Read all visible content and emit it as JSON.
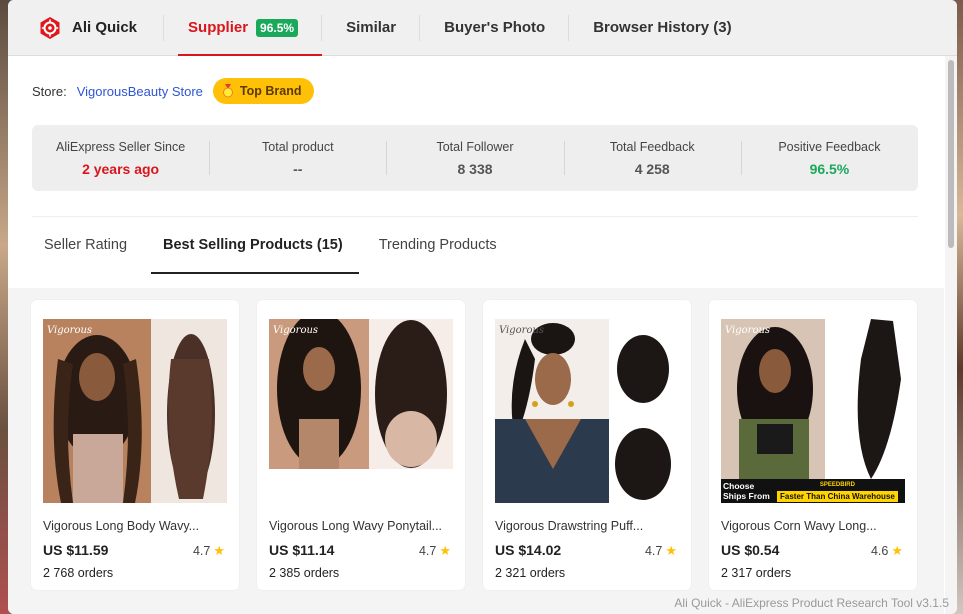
{
  "app": {
    "name": "Ali Quick",
    "footer": "Ali Quick - AliExpress Product Research Tool   v3.1.5"
  },
  "tabs": [
    {
      "label": "Supplier",
      "badge": "96.5%"
    },
    {
      "label": "Similar"
    },
    {
      "label": "Buyer's Photo"
    },
    {
      "label": "Browser History (3)"
    }
  ],
  "store": {
    "label": "Store:",
    "name": "VigorousBeauty Store",
    "badge": "Top Brand"
  },
  "stats": [
    {
      "label": "AliExpress Seller Since",
      "value": "2 years ago"
    },
    {
      "label": "Total product",
      "value": "--"
    },
    {
      "label": "Total Follower",
      "value": "8 338"
    },
    {
      "label": "Total Feedback",
      "value": "4 258"
    },
    {
      "label": "Positive Feedback",
      "value": "96.5%"
    }
  ],
  "subtabs": [
    {
      "label": "Seller Rating"
    },
    {
      "label": "Best Selling Products (15)"
    },
    {
      "label": "Trending Products"
    }
  ],
  "products": [
    {
      "title": "Vigorous Long Body Wavy...",
      "price": "US $11.59",
      "rating": "4.7",
      "orders": "2 768 orders"
    },
    {
      "title": "Vigorous Long Wavy Ponytail...",
      "price": "US $11.14",
      "rating": "4.7",
      "orders": "2 385 orders"
    },
    {
      "title": "Vigorous Drawstring Puff...",
      "price": "US $14.02",
      "rating": "4.7",
      "orders": "2 321 orders"
    },
    {
      "title": "Vigorous Corn Wavy Long...",
      "price": "US $0.54",
      "rating": "4.6",
      "orders": "2 317 orders",
      "image_texts": [
        "Choose",
        "Ships From",
        "SPEEDBIRD",
        "Faster Than China Warehouse"
      ]
    }
  ],
  "colors": {
    "accent_red": "#d8161c",
    "green": "#1aa85b",
    "gold": "#ffc107",
    "link": "#2f55d4"
  }
}
